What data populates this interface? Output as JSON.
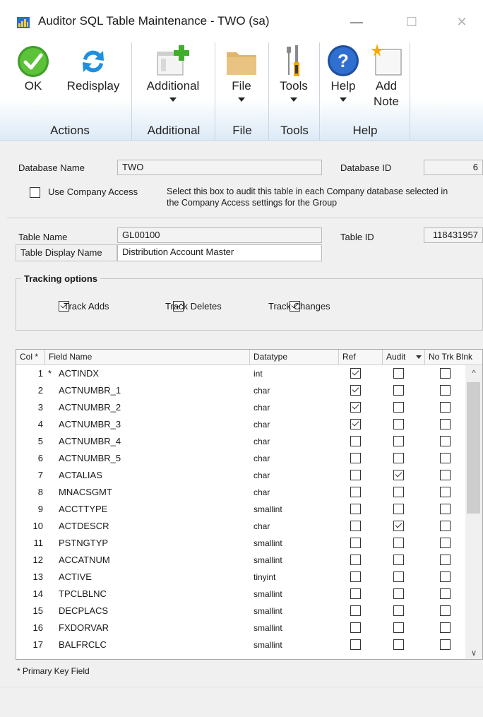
{
  "window": {
    "title": "Auditor SQL Table Maintenance  -  TWO (sa)",
    "minimize_glyph": "—",
    "maximize_glyph": "☐",
    "close_glyph": "✕"
  },
  "ribbon": {
    "ok": "OK",
    "redisplay": "Redisplay",
    "additional": "Additional",
    "file": "File",
    "tools": "Tools",
    "help": "Help",
    "add_note_1": "Add",
    "add_note_2": "Note",
    "groups": {
      "actions": "Actions",
      "additional": "Additional",
      "file": "File",
      "tools": "Tools",
      "help": "Help"
    },
    "colors": {
      "ok_green": "#4caf2e",
      "help_blue": "#1e5fb4",
      "redisplay_blue": "#1f8fe0",
      "file_tan": "#e0b66f"
    }
  },
  "form": {
    "database_name_label": "Database Name",
    "database_name_value": "TWO",
    "database_id_label": "Database ID",
    "database_id_value": "6",
    "use_company_access_label": "Use Company Access",
    "company_access_help_1": "Select this box to audit this table in each Company database selected in",
    "company_access_help_2": "the Company Access settings for the Group",
    "table_name_label": "Table Name",
    "table_name_value": "GL00100",
    "table_id_label": "Table ID",
    "table_id_value": "118431957",
    "table_display_name_label": "Table Display Name",
    "table_display_name_value": "Distribution Account Master"
  },
  "tracking": {
    "title": "Tracking options",
    "adds": "Track Adds",
    "deletes": "Track Deletes",
    "changes": "Track Changes"
  },
  "grid": {
    "headers": {
      "col": "Col *",
      "field_name": "Field Name",
      "datatype": "Datatype",
      "ref": "Ref",
      "audit": "Audit",
      "no_trk": "No Trk Blnk"
    },
    "rows": [
      {
        "col": "1",
        "pk": "*",
        "name": "ACTINDX",
        "type": "int",
        "ref": true,
        "audit": false,
        "notrk": false
      },
      {
        "col": "2",
        "pk": "",
        "name": "ACTNUMBR_1",
        "type": "char",
        "ref": true,
        "audit": false,
        "notrk": false
      },
      {
        "col": "3",
        "pk": "",
        "name": "ACTNUMBR_2",
        "type": "char",
        "ref": true,
        "audit": false,
        "notrk": false
      },
      {
        "col": "4",
        "pk": "",
        "name": "ACTNUMBR_3",
        "type": "char",
        "ref": true,
        "audit": false,
        "notrk": false
      },
      {
        "col": "5",
        "pk": "",
        "name": "ACTNUMBR_4",
        "type": "char",
        "ref": false,
        "audit": false,
        "notrk": false
      },
      {
        "col": "6",
        "pk": "",
        "name": "ACTNUMBR_5",
        "type": "char",
        "ref": false,
        "audit": false,
        "notrk": false
      },
      {
        "col": "7",
        "pk": "",
        "name": "ACTALIAS",
        "type": "char",
        "ref": false,
        "audit": true,
        "notrk": false
      },
      {
        "col": "8",
        "pk": "",
        "name": "MNACSGMT",
        "type": "char",
        "ref": false,
        "audit": false,
        "notrk": false
      },
      {
        "col": "9",
        "pk": "",
        "name": "ACCTTYPE",
        "type": "smallint",
        "ref": false,
        "audit": false,
        "notrk": false
      },
      {
        "col": "10",
        "pk": "",
        "name": "ACTDESCR",
        "type": "char",
        "ref": false,
        "audit": true,
        "notrk": false
      },
      {
        "col": "11",
        "pk": "",
        "name": "PSTNGTYP",
        "type": "smallint",
        "ref": false,
        "audit": false,
        "notrk": false
      },
      {
        "col": "12",
        "pk": "",
        "name": "ACCATNUM",
        "type": "smallint",
        "ref": false,
        "audit": false,
        "notrk": false
      },
      {
        "col": "13",
        "pk": "",
        "name": "ACTIVE",
        "type": "tinyint",
        "ref": false,
        "audit": false,
        "notrk": false
      },
      {
        "col": "14",
        "pk": "",
        "name": "TPCLBLNC",
        "type": "smallint",
        "ref": false,
        "audit": false,
        "notrk": false
      },
      {
        "col": "15",
        "pk": "",
        "name": "DECPLACS",
        "type": "smallint",
        "ref": false,
        "audit": false,
        "notrk": false
      },
      {
        "col": "16",
        "pk": "",
        "name": "FXDORVAR",
        "type": "smallint",
        "ref": false,
        "audit": false,
        "notrk": false
      },
      {
        "col": "17",
        "pk": "",
        "name": "BALFRCLC",
        "type": "smallint",
        "ref": false,
        "audit": false,
        "notrk": false
      }
    ],
    "scroll_up": "^",
    "scroll_down": "∨"
  },
  "footnote": "* Primary Key Field"
}
